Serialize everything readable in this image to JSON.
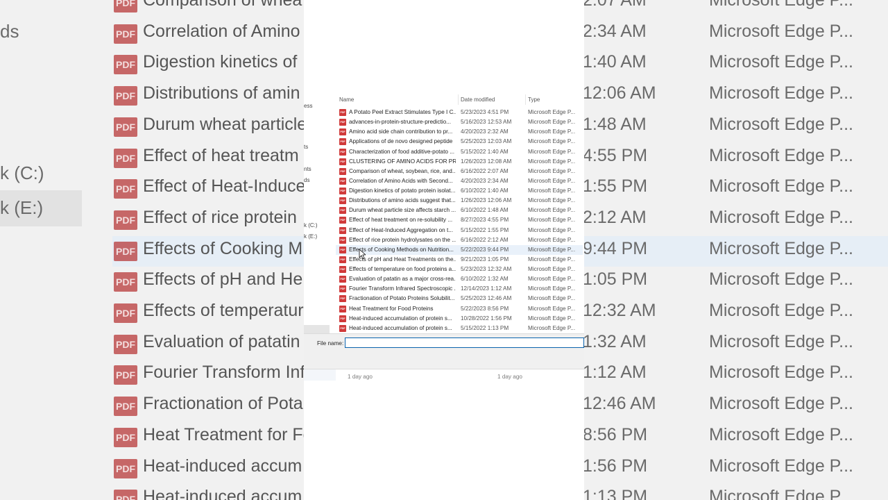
{
  "background": {
    "nav": [
      "ds",
      "k (C:)",
      "k (E:)"
    ],
    "rows": [
      {
        "name": "Comparison of whea",
        "time": "2:07 AM",
        "type": "Microsoft Edge P..."
      },
      {
        "name": "Correlation of Amino",
        "time": "2:34 AM",
        "type": "Microsoft Edge P..."
      },
      {
        "name": "Digestion kinetics of",
        "time": "1:40 AM",
        "type": "Microsoft Edge P..."
      },
      {
        "name": "Distributions of amin",
        "time": "12:06 AM",
        "type": "Microsoft Edge P..."
      },
      {
        "name": "Durum wheat particle",
        "time": "1:48 AM",
        "type": "Microsoft Edge P..."
      },
      {
        "name": "Effect of heat treatm",
        "time": "4:55 PM",
        "type": "Microsoft Edge P..."
      },
      {
        "name": "Effect of Heat-Induce",
        "time": "1:55 PM",
        "type": "Microsoft Edge P..."
      },
      {
        "name": "Effect of rice protein",
        "time": "2:12 AM",
        "type": "Microsoft Edge P..."
      },
      {
        "name": "Effects of Cooking M",
        "time": "9:44 PM",
        "type": "Microsoft Edge P..."
      },
      {
        "name": "Effects of pH and He",
        "time": "1:05 PM",
        "type": "Microsoft Edge P..."
      },
      {
        "name": "Effects of temperatur",
        "time": "12:32 AM",
        "type": "Microsoft Edge P..."
      },
      {
        "name": "Evaluation of patatin",
        "time": "1:32 AM",
        "type": "Microsoft Edge P..."
      },
      {
        "name": "Fourier Transform Inf",
        "time": "1:12 AM",
        "type": "Microsoft Edge P..."
      },
      {
        "name": "Fractionation of Pota",
        "time": "12:46 AM",
        "type": "Microsoft Edge P..."
      },
      {
        "name": "Heat Treatment for Fo",
        "time": "8:56 PM",
        "type": "Microsoft Edge P..."
      },
      {
        "name": "Heat-induced accum",
        "time": "1:56 PM",
        "type": "Microsoft Edge P..."
      },
      {
        "name": "Heat-induced accum",
        "time": "1:13 PM",
        "type": "Microsoft Edge P..."
      }
    ]
  },
  "dialog": {
    "nav": [
      "ess",
      "ts",
      "nts",
      "ds",
      "k (C:)",
      "k (E:)"
    ],
    "columns": {
      "name": "Name",
      "date": "Date modified",
      "type": "Type"
    },
    "files": [
      {
        "name": "A Potato Peel Extract Stimulates Type I C...",
        "date": "5/23/2023 4:51 PM",
        "type": "Microsoft Edge P..."
      },
      {
        "name": "advances-in-protein-structure-predictio...",
        "date": "5/16/2023 12:53 AM",
        "type": "Microsoft Edge P..."
      },
      {
        "name": "Amino acid side chain contribution to pr...",
        "date": "4/20/2023 2:32 AM",
        "type": "Microsoft Edge P..."
      },
      {
        "name": "Applications of de novo designed peptide",
        "date": "5/25/2023 12:03 AM",
        "type": "Microsoft Edge P..."
      },
      {
        "name": "Characterization of food additive-potato ...",
        "date": "5/15/2022 1:40 AM",
        "type": "Microsoft Edge P..."
      },
      {
        "name": "CLUSTERING OF AMINO ACIDS FOR PRO...",
        "date": "1/26/2023 12:08 AM",
        "type": "Microsoft Edge P..."
      },
      {
        "name": "Comparison of wheat, soybean, rice, and...",
        "date": "6/16/2022 2:07 AM",
        "type": "Microsoft Edge P..."
      },
      {
        "name": "Correlation of Amino Acids with Second...",
        "date": "4/20/2023 2:34 AM",
        "type": "Microsoft Edge P..."
      },
      {
        "name": "Digestion kinetics of potato protein isolat...",
        "date": "6/10/2022 1:40 AM",
        "type": "Microsoft Edge P..."
      },
      {
        "name": "Distributions of amino acids suggest that...",
        "date": "1/26/2023 12:06 AM",
        "type": "Microsoft Edge P..."
      },
      {
        "name": "Durum wheat particle size affects starch ...",
        "date": "6/10/2022 1:48 AM",
        "type": "Microsoft Edge P..."
      },
      {
        "name": "Effect of heat treatment on re-solubility ...",
        "date": "8/27/2023 4:55 PM",
        "type": "Microsoft Edge P..."
      },
      {
        "name": "Effect of Heat-Induced Aggregation on t...",
        "date": "5/15/2022 1:55 PM",
        "type": "Microsoft Edge P..."
      },
      {
        "name": "Effect of rice protein hydrolysates on the ...",
        "date": "6/16/2022 2:12 AM",
        "type": "Microsoft Edge P..."
      },
      {
        "name": "Effects of Cooking Methods on Nutrition...",
        "date": "5/22/2023 9:44 PM",
        "type": "Microsoft Edge P..."
      },
      {
        "name": "Effects of pH and Heat Treatments on the...",
        "date": "9/21/2023 1:05 PM",
        "type": "Microsoft Edge P..."
      },
      {
        "name": "Effects of temperature on food proteins a...",
        "date": "5/23/2023 12:32 AM",
        "type": "Microsoft Edge P..."
      },
      {
        "name": "Evaluation of patatin as a major cross-rea...",
        "date": "6/10/2022 1:32 AM",
        "type": "Microsoft Edge P..."
      },
      {
        "name": "Fourier Transform Infrared Spectroscopic ...",
        "date": "12/14/2023 1:12 AM",
        "type": "Microsoft Edge P..."
      },
      {
        "name": "Fractionation of Potato Proteins Solubilit...",
        "date": "5/25/2023 12:46 AM",
        "type": "Microsoft Edge P..."
      },
      {
        "name": "Heat Treatment for Food Proteins",
        "date": "5/22/2023 8:56 PM",
        "type": "Microsoft Edge P..."
      },
      {
        "name": "Heat-induced accumulation of protein s...",
        "date": "10/28/2022 1:56 PM",
        "type": "Microsoft Edge P..."
      },
      {
        "name": "Heat-induced accumulation of protein s...",
        "date": "5/15/2022 1:13 PM",
        "type": "Microsoft Edge P..."
      }
    ],
    "highlighted_index": 14,
    "file_name_label": "File name:",
    "file_name_value": "",
    "below": [
      "1 day ago",
      "1 day ago"
    ],
    "icon_text": "PDF"
  }
}
